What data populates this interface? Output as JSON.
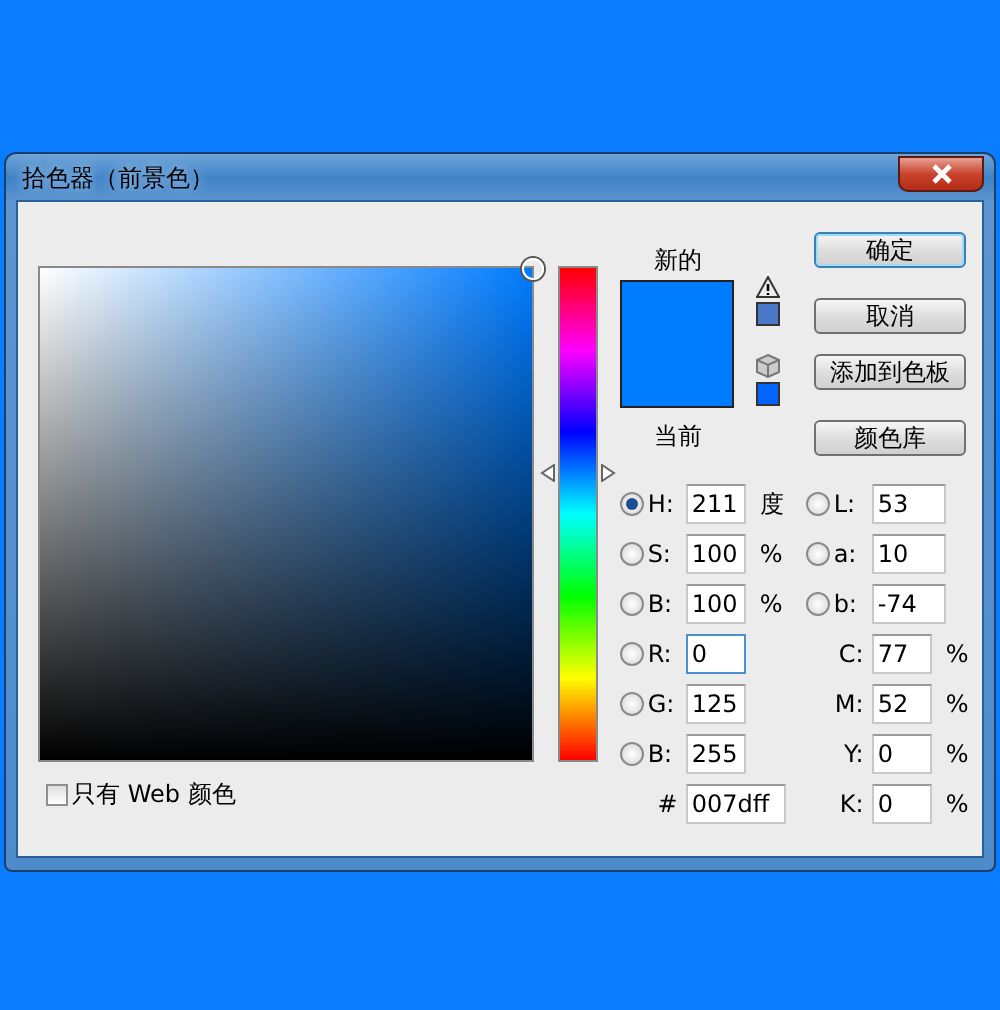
{
  "window": {
    "title": "拾色器（前景色）"
  },
  "preview": {
    "new_label": "新的",
    "current_label": "当前"
  },
  "buttons": [
    {
      "label": "确定",
      "default": true
    },
    {
      "label": "取消",
      "default": false
    },
    {
      "label": "添加到色板",
      "default": false
    },
    {
      "label": "颜色库",
      "default": false
    }
  ],
  "hsb": [
    {
      "label": "H:",
      "value": "211",
      "unit": "度",
      "selected": true
    },
    {
      "label": "S:",
      "value": "100",
      "unit": "%",
      "selected": false
    },
    {
      "label": "B:",
      "value": "100",
      "unit": "%",
      "selected": false
    }
  ],
  "lab": [
    {
      "label": "L:",
      "value": "53",
      "selected": false
    },
    {
      "label": "a:",
      "value": "10",
      "selected": false
    },
    {
      "label": "b:",
      "value": "-74",
      "selected": false
    }
  ],
  "rgb": [
    {
      "label": "R:",
      "value": "0",
      "selected": false,
      "focused": true
    },
    {
      "label": "G:",
      "value": "125",
      "selected": false,
      "focused": false
    },
    {
      "label": "B:",
      "value": "255",
      "selected": false,
      "focused": false
    }
  ],
  "hex": {
    "label": "#",
    "value": "007dff"
  },
  "cmyk": [
    {
      "label": "C:",
      "value": "77",
      "unit": "%"
    },
    {
      "label": "M:",
      "value": "52",
      "unit": "%"
    },
    {
      "label": "Y:",
      "value": "0",
      "unit": "%"
    },
    {
      "label": "K:",
      "value": "0",
      "unit": "%"
    }
  ],
  "web_only": {
    "label": "只有 Web 颜色",
    "checked": false
  }
}
